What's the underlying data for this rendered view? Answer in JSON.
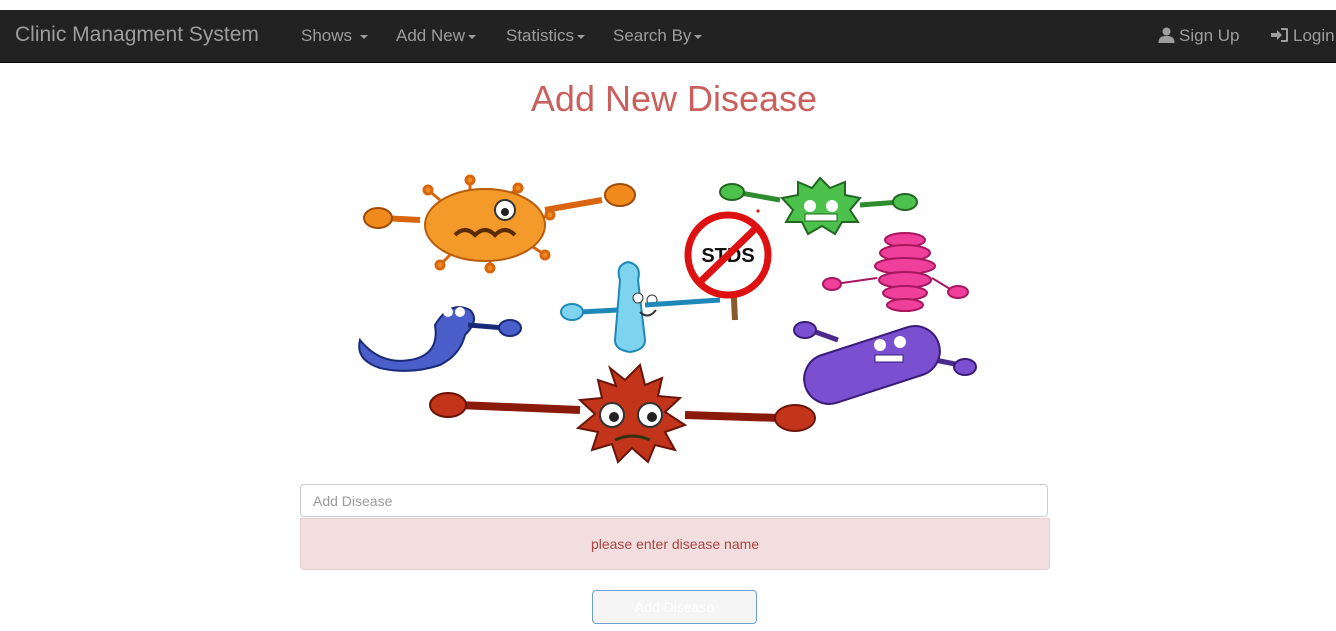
{
  "navbar": {
    "brand": "Clinic Managment System",
    "items": [
      {
        "label": "Shows "
      },
      {
        "label": "Add New"
      },
      {
        "label": "Statistics"
      },
      {
        "label": "Search By"
      }
    ],
    "right": [
      {
        "label": "Sign Up",
        "icon": "user-icon"
      },
      {
        "label": "Login",
        "icon": "login-icon"
      }
    ]
  },
  "page": {
    "title": "Add New Disease",
    "illustration": {
      "sign_text": "STDS"
    }
  },
  "form": {
    "input_placeholder": "Add Disease",
    "input_value": "",
    "error": "please enter disease name",
    "submit_label": "Add Disease"
  },
  "colors": {
    "navbar_bg": "#222222",
    "title": "#c9605e",
    "alert_bg": "#f2dede",
    "alert_text": "#a94442"
  }
}
